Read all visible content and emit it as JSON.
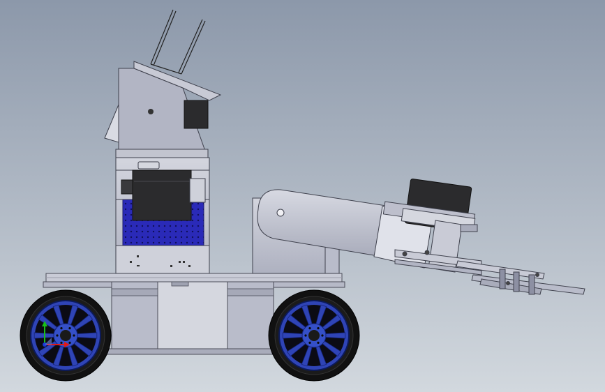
{
  "viewport": {
    "background_top": "#8c98aa",
    "background_bottom": "#d2d8de"
  },
  "model": {
    "parts": [
      "chassis",
      "front-wheel",
      "rear-wheel",
      "turret-tower",
      "head-servo",
      "camera-head",
      "antenna",
      "robot-arm",
      "arm-servo",
      "gripper"
    ],
    "colors": {
      "metal_light": "#c6c8d3",
      "metal_mid": "#aeb1c0",
      "metal_dark": "#8d90a3",
      "servo_black": "#2b2b2d",
      "blue_body": "#2a2ab8",
      "tire": "#111111",
      "rim_blue": "#2f44b6"
    }
  },
  "triad": {
    "x_color": "#e01818",
    "y_color": "#18c018",
    "z_color": "#1a3ad8"
  }
}
